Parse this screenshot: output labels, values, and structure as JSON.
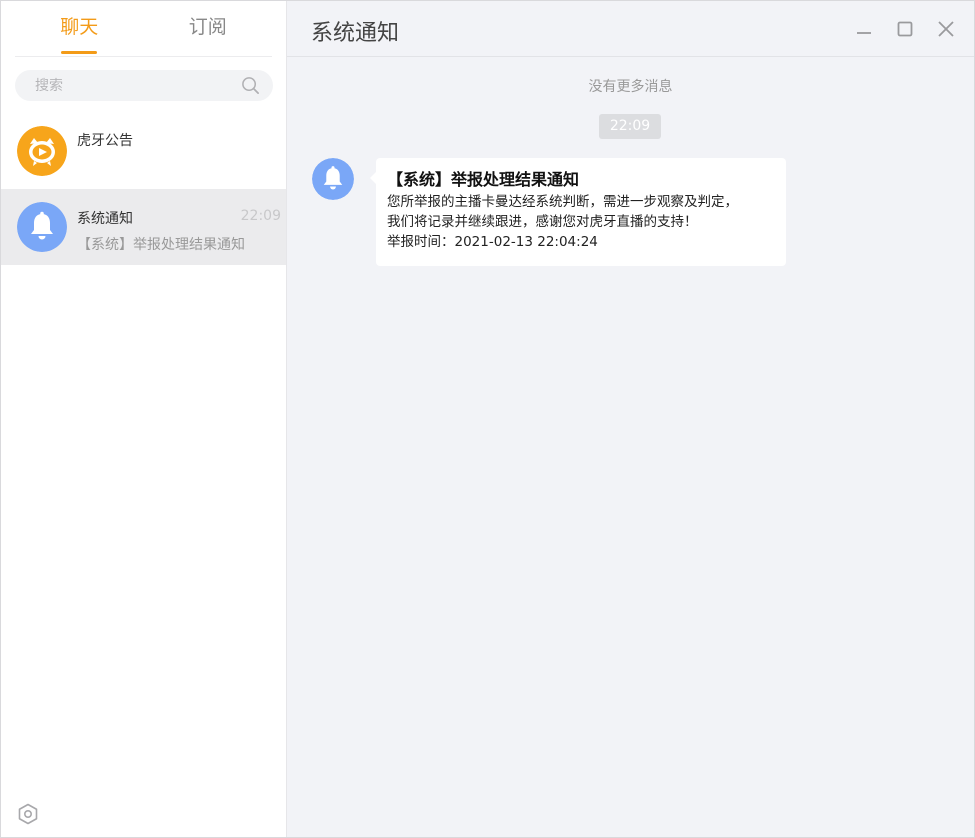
{
  "sidebar": {
    "tabs": [
      {
        "label": "聊天",
        "active": true
      },
      {
        "label": "订阅",
        "active": false
      }
    ],
    "search": {
      "placeholder": "搜索",
      "value": ""
    },
    "conversations": [
      {
        "name": "虎牙公告",
        "time": "",
        "preview": "",
        "icon": "huya-logo",
        "selected": false
      },
      {
        "name": "系统通知",
        "time": "22:09",
        "preview": "【系统】举报处理结果通知",
        "icon": "bell-icon",
        "selected": true
      }
    ],
    "settings_icon": "settings-hexagon-icon"
  },
  "main": {
    "title": "系统通知",
    "window_controls": [
      "minimize-icon",
      "maximize-icon",
      "close-icon"
    ],
    "no_more_text": "没有更多消息",
    "time_badge": "22:09",
    "message": {
      "title": "【系统】举报处理结果通知",
      "lines": [
        "您所举报的主播卡曼达经系统判断，需进一步观察及判定，",
        "我们将记录并继续跟进，感谢您对虎牙直播的支持！",
        "举报时间：2021-02-13 22:04:24"
      ]
    }
  },
  "colors": {
    "accent": "#f39b18",
    "bell_avatar": "#7aa7f7",
    "huya_avatar": "#f7a51b",
    "main_bg": "#f2f3f7"
  }
}
